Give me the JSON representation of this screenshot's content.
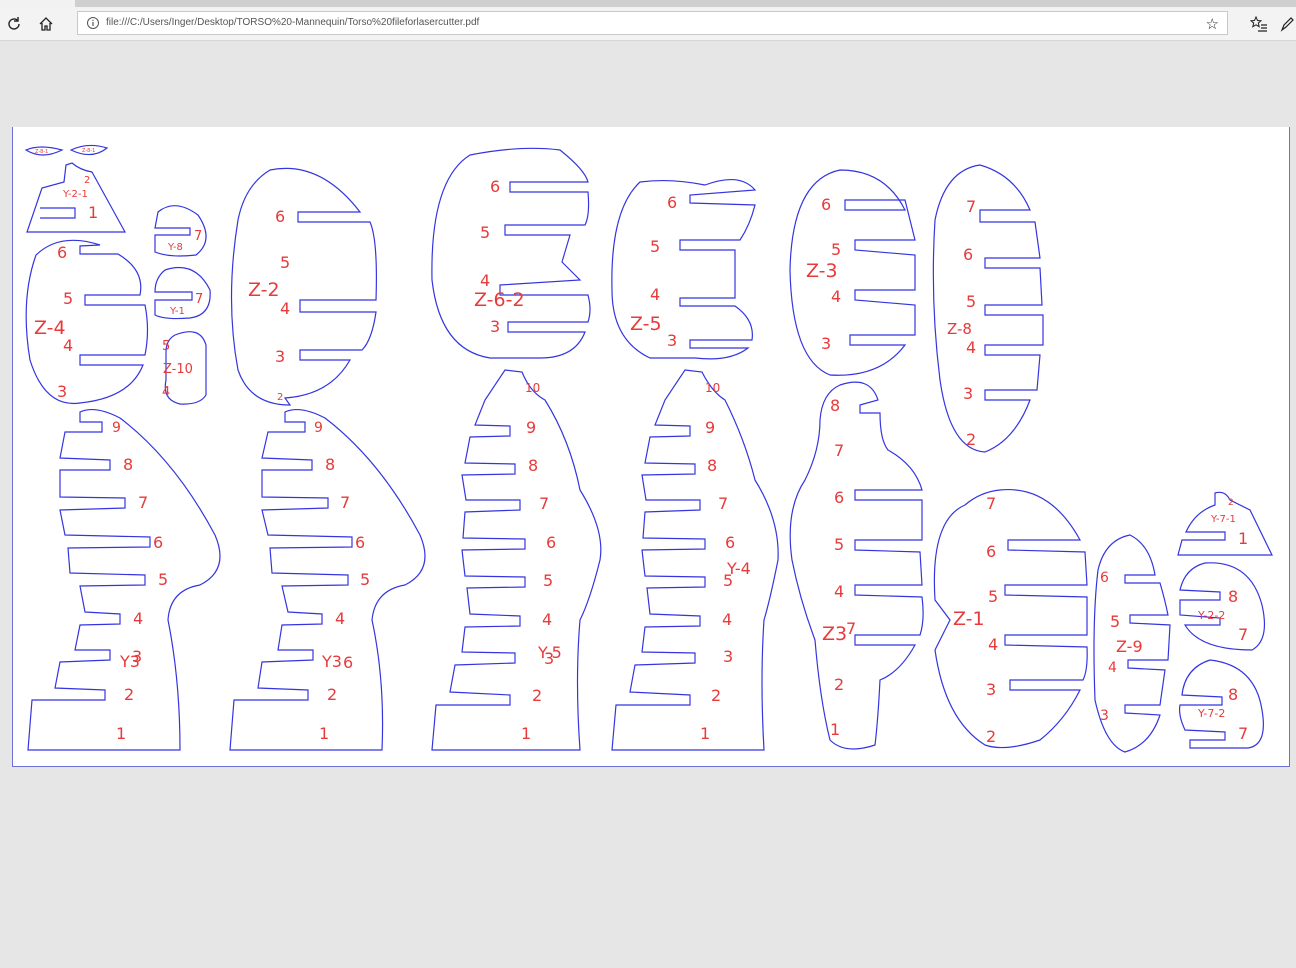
{
  "browser": {
    "url": "file:///C:/Users/Inger/Desktop/TORSO%20-Mannequin/Torso%20fileforlasercutter.pdf",
    "icons": {
      "refresh": "refresh-icon",
      "home": "home-icon",
      "info": "info-icon",
      "favorite": "star-icon",
      "favorites_list": "favorites-list-icon",
      "annotate": "pen-icon"
    }
  },
  "document": {
    "stroke_color": "#3535e0",
    "label_color": "#e83a3a",
    "part_labels": [
      "Y-2-1",
      "Y-8",
      "Y-1",
      "Z-10",
      "Z-4",
      "Z-2",
      "Z-6-2",
      "Z-5",
      "Z-3",
      "Z-8",
      "Y3",
      "Y3",
      "Y-5",
      "Y-4",
      "Z3",
      "Z-1",
      "Z-9",
      "Y-7-1",
      "Y-2-2",
      "Y-7-2"
    ],
    "tiny_labels": [
      "Z-8-1",
      "Z-8-1"
    ]
  }
}
